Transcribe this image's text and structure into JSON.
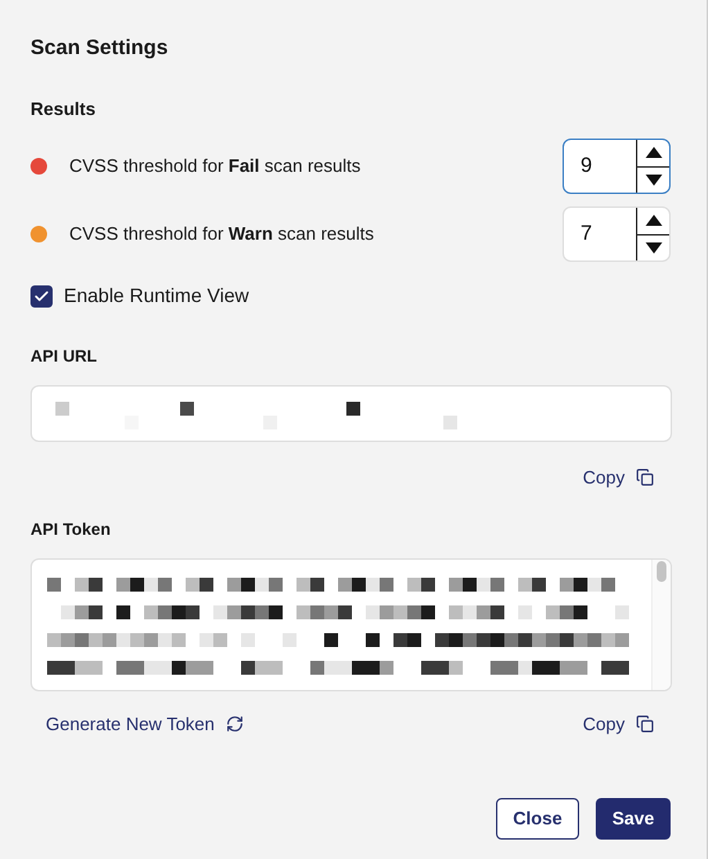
{
  "title": "Scan Settings",
  "results": {
    "heading": "Results",
    "thresholds": [
      {
        "label": "CVSS threshold for **Fail** scan results",
        "color": "#e5483b",
        "value": "9",
        "focused": true
      },
      {
        "label": "CVSS threshold for **Warn** scan results",
        "color": "#f0922f",
        "value": "7",
        "focused": false
      }
    ]
  },
  "runtime_view": {
    "label": "Enable Runtime View",
    "checked": true
  },
  "api_url": {
    "label": "API URL",
    "copy": "Copy"
  },
  "api_token": {
    "label": "API Token",
    "generate": "Generate New Token",
    "copy": "Copy"
  },
  "buttons": {
    "close": "Close",
    "save": "Save"
  }
}
